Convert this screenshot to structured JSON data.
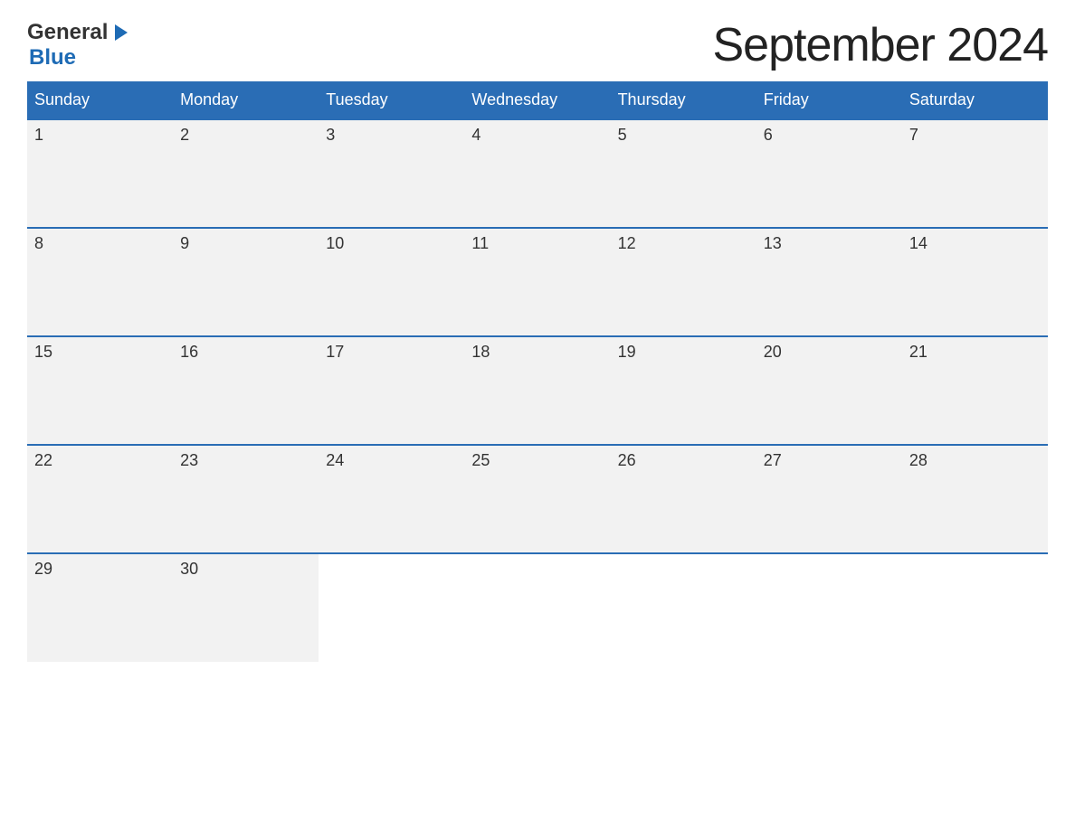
{
  "logo": {
    "general_text": "General",
    "blue_text": "Blue"
  },
  "header": {
    "title": "September 2024"
  },
  "weekdays": [
    "Sunday",
    "Monday",
    "Tuesday",
    "Wednesday",
    "Thursday",
    "Friday",
    "Saturday"
  ],
  "weeks": [
    [
      {
        "day": "1",
        "has_date": true
      },
      {
        "day": "2",
        "has_date": true
      },
      {
        "day": "3",
        "has_date": true
      },
      {
        "day": "4",
        "has_date": true
      },
      {
        "day": "5",
        "has_date": true
      },
      {
        "day": "6",
        "has_date": true
      },
      {
        "day": "7",
        "has_date": true
      }
    ],
    [
      {
        "day": "8",
        "has_date": true
      },
      {
        "day": "9",
        "has_date": true
      },
      {
        "day": "10",
        "has_date": true
      },
      {
        "day": "11",
        "has_date": true
      },
      {
        "day": "12",
        "has_date": true
      },
      {
        "day": "13",
        "has_date": true
      },
      {
        "day": "14",
        "has_date": true
      }
    ],
    [
      {
        "day": "15",
        "has_date": true
      },
      {
        "day": "16",
        "has_date": true
      },
      {
        "day": "17",
        "has_date": true
      },
      {
        "day": "18",
        "has_date": true
      },
      {
        "day": "19",
        "has_date": true
      },
      {
        "day": "20",
        "has_date": true
      },
      {
        "day": "21",
        "has_date": true
      }
    ],
    [
      {
        "day": "22",
        "has_date": true
      },
      {
        "day": "23",
        "has_date": true
      },
      {
        "day": "24",
        "has_date": true
      },
      {
        "day": "25",
        "has_date": true
      },
      {
        "day": "26",
        "has_date": true
      },
      {
        "day": "27",
        "has_date": true
      },
      {
        "day": "28",
        "has_date": true
      }
    ],
    [
      {
        "day": "29",
        "has_date": true
      },
      {
        "day": "30",
        "has_date": true
      },
      {
        "day": "",
        "has_date": false
      },
      {
        "day": "",
        "has_date": false
      },
      {
        "day": "",
        "has_date": false
      },
      {
        "day": "",
        "has_date": false
      },
      {
        "day": "",
        "has_date": false
      }
    ]
  ]
}
